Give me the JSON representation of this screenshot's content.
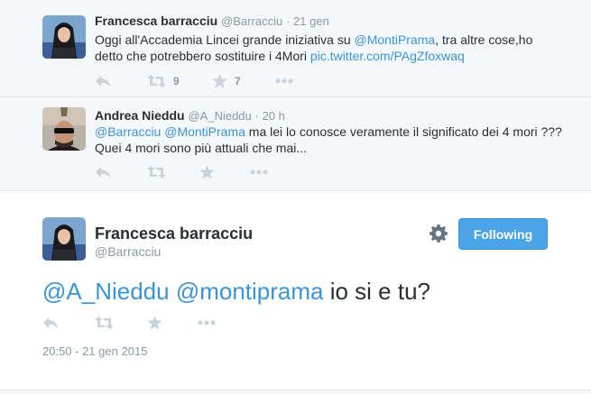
{
  "context_tweets": [
    {
      "fullname": "Francesca barracciu",
      "username": "@Barracciu",
      "time": "21 gen",
      "text_parts": [
        "Oggi all'Accademia Lincei grande iniziativa su ",
        "@MontiPrama",
        ", tra altre cose,ho detto che potrebbero sostituire i 4Mori ",
        "pic.twitter.com/PAgZfoxwaq"
      ],
      "retweet_count": "9",
      "favorite_count": "7"
    },
    {
      "fullname": "Andrea Nieddu",
      "username": "@A_Nieddu",
      "time": "20 h",
      "text_parts": [
        "@Barracciu",
        " ",
        "@MontiPrama",
        " ma lei lo conosce veramente il significato dei 4 mori ??? Quei 4 mori sono più attuali che mai..."
      ]
    }
  ],
  "main_tweet": {
    "fullname": "Francesca barracciu",
    "username": "@Barracciu",
    "follow_label": "Following",
    "text_parts": [
      "@A_Nieddu",
      " ",
      "@montiprama",
      " io si e tu?"
    ],
    "date": "20:50 - 21 gen 2015"
  },
  "icons": {
    "reply": "reply-icon",
    "retweet": "retweet-icon",
    "favorite": "star-icon",
    "more": "more-icon",
    "settings": "gear-icon"
  },
  "colors": {
    "link": "#3b94d9",
    "follow_button": "#4ba3e8",
    "muted": "#8899a6",
    "context_bg": "#f5f8fa"
  }
}
